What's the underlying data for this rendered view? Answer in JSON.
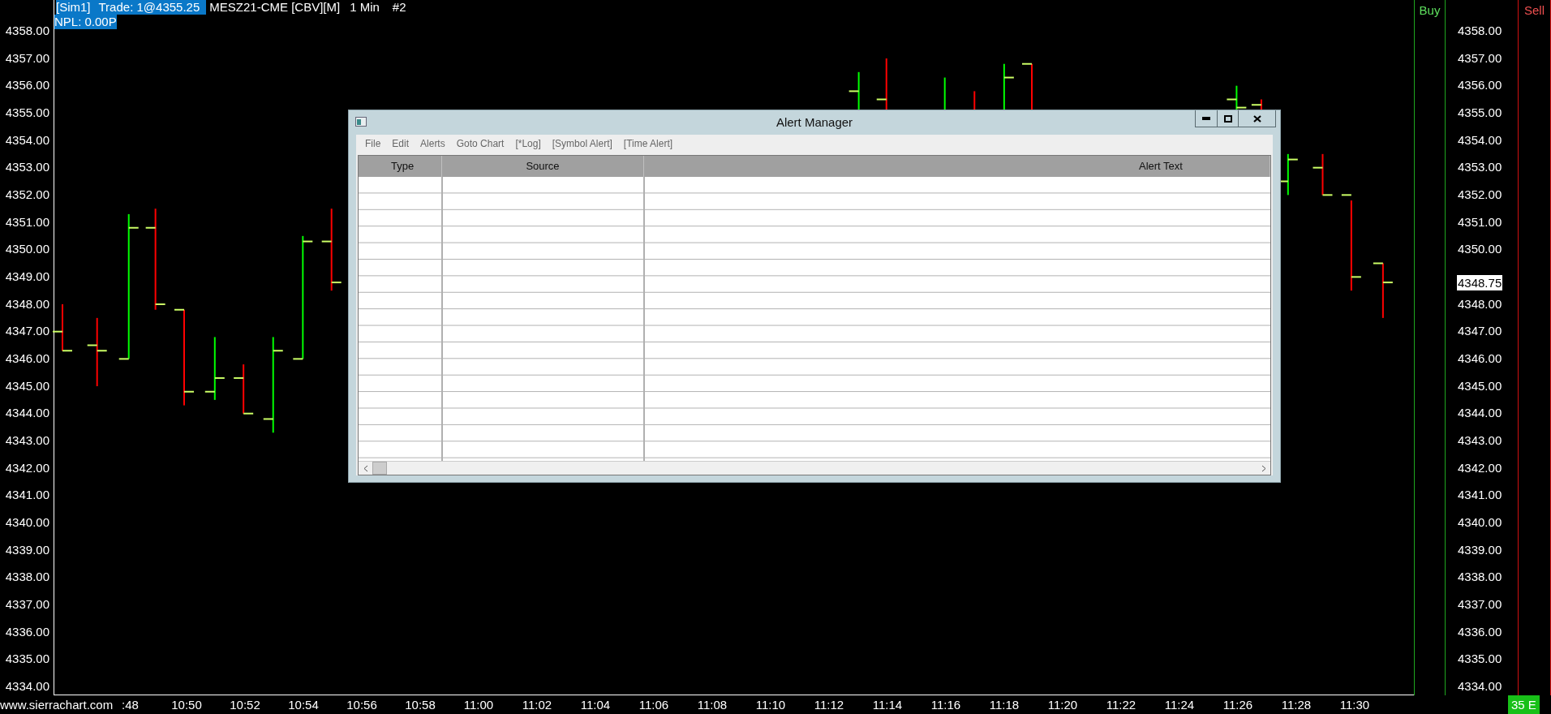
{
  "chart_header": {
    "account": "[Sim1]",
    "trade": "Trade: 1@4355.25",
    "symbol": "MESZ21-CME [CBV][M]",
    "interval": "1 Min",
    "chart_number": "#2",
    "npl": "NPL: 0.00P"
  },
  "left_axis": [
    "4358.00",
    "4357.00",
    "4356.00",
    "4355.00",
    "4354.00",
    "4353.00",
    "4352.00",
    "4351.00",
    "4350.00",
    "4349.00",
    "4348.00",
    "4347.00",
    "4346.00",
    "4345.00",
    "4344.00",
    "4343.00",
    "4342.00",
    "4341.00",
    "4340.00",
    "4339.00",
    "4338.00",
    "4337.00",
    "4336.00",
    "4335.00",
    "4334.00"
  ],
  "right_axis": [
    {
      "kind": "price",
      "label": "4358.00"
    },
    {
      "kind": "price",
      "label": "4357.00"
    },
    {
      "kind": "price",
      "label": "4356.00"
    },
    {
      "kind": "price",
      "label": "4355.00"
    },
    {
      "kind": "price",
      "label": "4354.00"
    },
    {
      "kind": "price",
      "label": "4353.00"
    },
    {
      "kind": "price",
      "label": "4352.00"
    },
    {
      "kind": "price",
      "label": "4351.00"
    },
    {
      "kind": "price",
      "label": "4350.00"
    },
    {
      "kind": "current",
      "label": "4348.75"
    },
    {
      "kind": "price",
      "label": "4348.00"
    },
    {
      "kind": "price",
      "label": "4347.00"
    },
    {
      "kind": "price",
      "label": "4346.00"
    },
    {
      "kind": "price",
      "label": "4345.00"
    },
    {
      "kind": "price",
      "label": "4344.00"
    },
    {
      "kind": "price",
      "label": "4343.00"
    },
    {
      "kind": "price",
      "label": "4342.00"
    },
    {
      "kind": "price",
      "label": "4341.00"
    },
    {
      "kind": "price",
      "label": "4340.00"
    },
    {
      "kind": "price",
      "label": "4339.00"
    },
    {
      "kind": "price",
      "label": "4338.00"
    },
    {
      "kind": "price",
      "label": "4337.00"
    },
    {
      "kind": "price",
      "label": "4336.00"
    },
    {
      "kind": "price",
      "label": "4335.00"
    },
    {
      "kind": "price",
      "label": "4334.00"
    }
  ],
  "time_axis": {
    "website": "www.sierrachart.com",
    "first_label": ":48",
    "labels": [
      "10:50",
      "10:52",
      "10:54",
      "10:56",
      "10:58",
      "11:00",
      "11:02",
      "11:04",
      "11:06",
      "11:08",
      "11:10",
      "11:12",
      "11:14",
      "11:16",
      "11:18",
      "11:20",
      "11:22",
      "11:24",
      "11:26",
      "11:28",
      "11:30"
    ]
  },
  "buy_column": {
    "label": "Buy"
  },
  "sell_column": {
    "label": "Sell",
    "badge": "35 E"
  },
  "alert_window": {
    "title": "Alert Manager",
    "menu": [
      "File",
      "Edit",
      "Alerts",
      "Goto Chart",
      "[*Log]",
      "[Symbol Alert]",
      "[Time Alert]"
    ],
    "columns": [
      "Type",
      "Source",
      "Alert Text"
    ]
  }
}
